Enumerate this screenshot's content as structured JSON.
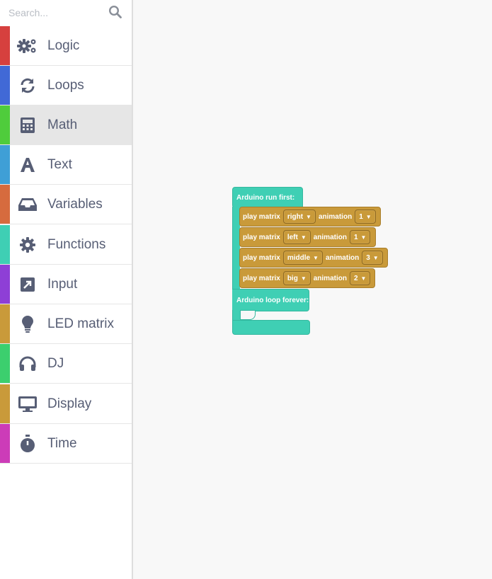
{
  "search": {
    "placeholder": "Search...",
    "icon": "search-icon"
  },
  "categories": [
    {
      "label": "Logic",
      "color": "#d6403e",
      "icon": "gears-icon"
    },
    {
      "label": "Loops",
      "color": "#4169d6",
      "icon": "sync-icon"
    },
    {
      "label": "Math",
      "color": "#4fcc3c",
      "icon": "calculator-icon",
      "selected": true
    },
    {
      "label": "Text",
      "color": "#3f9fd6",
      "icon": "font-icon"
    },
    {
      "label": "Variables",
      "color": "#d66b3e",
      "icon": "inbox-icon"
    },
    {
      "label": "Functions",
      "color": "#3fcfb4",
      "icon": "cog-icon"
    },
    {
      "label": "Input",
      "color": "#8e3fd6",
      "icon": "external-link-icon"
    },
    {
      "label": "LED matrix",
      "color": "#c99a3a",
      "icon": "lightbulb-icon"
    },
    {
      "label": "DJ",
      "color": "#3ccf6e",
      "icon": "headphones-icon"
    },
    {
      "label": "Display",
      "color": "#c99a3a",
      "icon": "desktop-icon"
    },
    {
      "label": "Time",
      "color": "#cc3cb8",
      "icon": "stopwatch-icon"
    }
  ],
  "blocks": {
    "setup_label": "Arduino run first:",
    "loop_label": "Arduino loop forever:",
    "statements": [
      {
        "play": "play matrix",
        "matrix": "right",
        "anim_label": "animation",
        "anim": "1"
      },
      {
        "play": "play matrix",
        "matrix": "left",
        "anim_label": "animation",
        "anim": "1"
      },
      {
        "play": "play matrix",
        "matrix": "middle",
        "anim_label": "animation",
        "anim": "3"
      },
      {
        "play": "play matrix",
        "matrix": "big",
        "anim_label": "animation",
        "anim": "2"
      }
    ]
  },
  "colors": {
    "accent_block": "#3fcfb4",
    "led_block": "#c99a3a",
    "sidebar_text": "#575e75"
  }
}
